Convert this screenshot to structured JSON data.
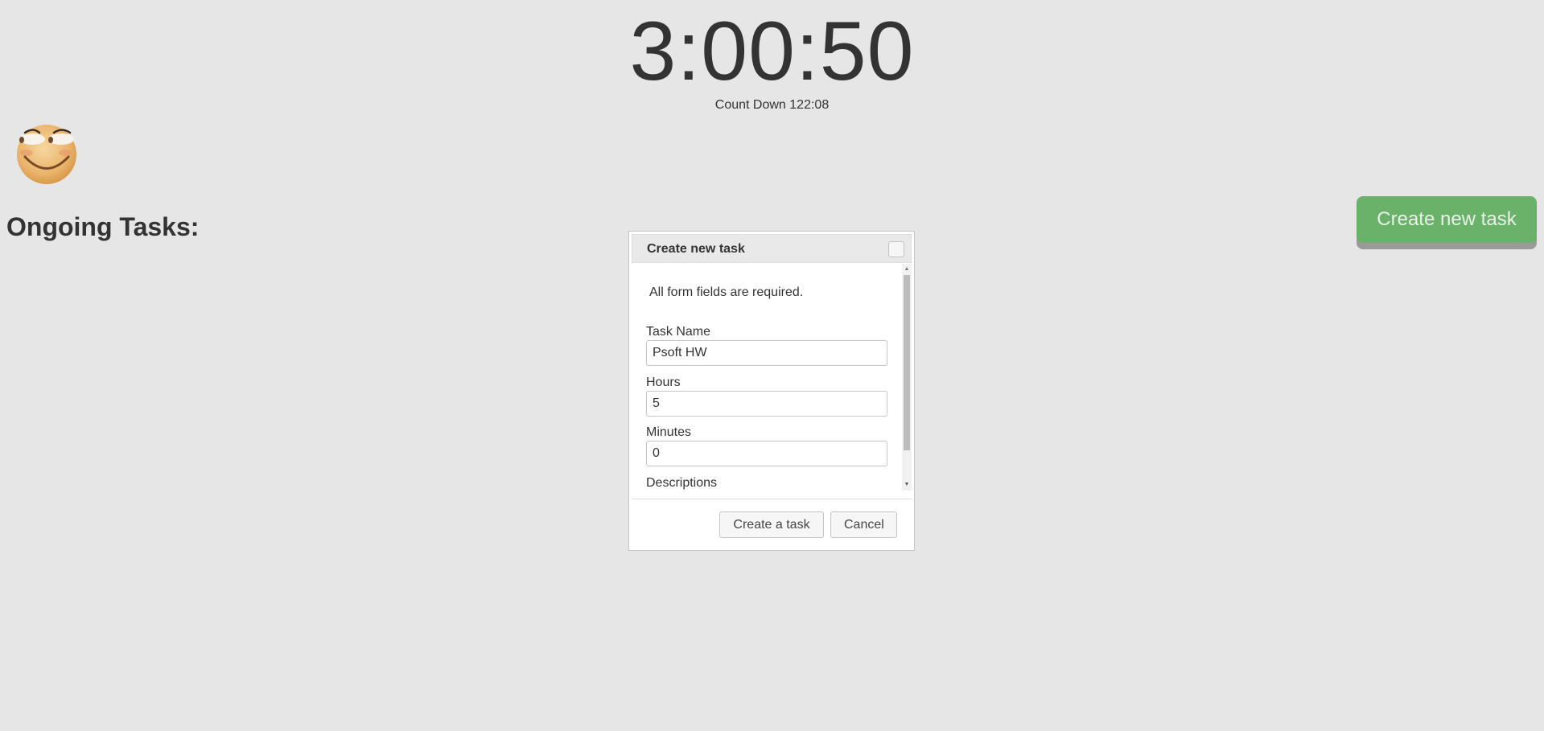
{
  "header": {
    "clock": "3:00:50",
    "countdown": "Count Down 122:08"
  },
  "avatar": {
    "icon": "smiling-face-icon"
  },
  "tasks": {
    "heading": "Ongoing Tasks:"
  },
  "toolbar": {
    "create_label": "Create new task",
    "create_color": "#6ab26a"
  },
  "dialog": {
    "title": "Create new task",
    "note": "All form fields are required.",
    "fields": [
      {
        "label": "Task Name",
        "value": "Psoft HW"
      },
      {
        "label": "Hours",
        "value": "5"
      },
      {
        "label": "Minutes",
        "value": "0"
      },
      {
        "label": "Descriptions"
      }
    ],
    "submit_label": "Create a task",
    "cancel_label": "Cancel"
  }
}
